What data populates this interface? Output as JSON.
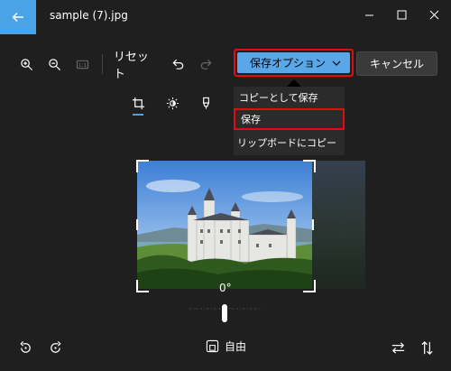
{
  "window": {
    "title": "sample (7).jpg"
  },
  "toolbar": {
    "reset_label": "リセット",
    "save_options_label": "保存オプション",
    "cancel_label": "キャンセル"
  },
  "save_menu": {
    "items": [
      {
        "label": "コピーとして保存"
      },
      {
        "label": "保存"
      },
      {
        "label": "リップボードにコピー"
      }
    ]
  },
  "editor": {
    "angle": "0°",
    "aspect_label": "自由"
  },
  "colors": {
    "accent": "#5aa7e8",
    "highlight": "#e30b0b",
    "background": "#1f1f1f"
  },
  "icons": [
    "back-arrow-icon",
    "zoom-in-icon",
    "zoom-out-icon",
    "actual-size-icon",
    "undo-icon",
    "redo-icon",
    "chevron-down-icon",
    "crop-icon",
    "brightness-icon",
    "markup-icon",
    "rotate-left-icon",
    "rotate-right-icon",
    "aspect-ratio-icon",
    "flip-horizontal-icon",
    "flip-vertical-icon"
  ]
}
